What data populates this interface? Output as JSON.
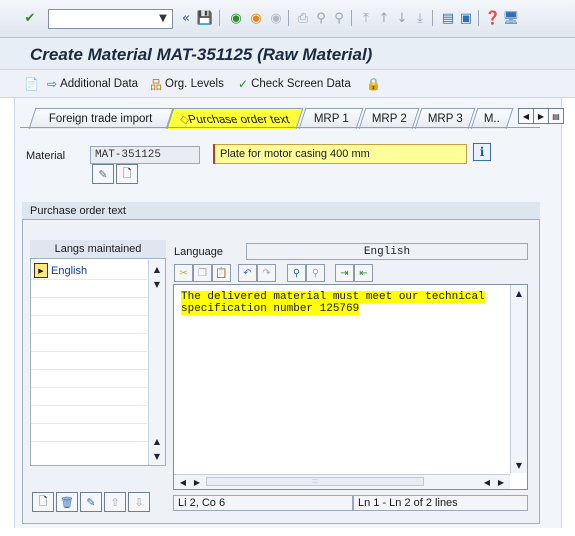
{
  "system_toolbar": {
    "command_field_value": "",
    "icons": [
      "enter-icon",
      "save-icon",
      "back-icon",
      "exit-icon",
      "cancel-icon",
      "print-icon",
      "find-icon",
      "find-next-icon",
      "first-page-icon",
      "prev-page-icon",
      "next-page-icon",
      "last-page-icon",
      "new-session-icon",
      "shortcut-icon",
      "help-icon",
      "customize-layout-icon"
    ]
  },
  "title": "Create Material MAT-351125 (Raw Material)",
  "app_toolbar": {
    "additional_data": "Additional Data",
    "org_levels": "Org. Levels",
    "check_screen_data": "Check Screen Data"
  },
  "tabs": [
    {
      "label": "Foreign trade import"
    },
    {
      "label": "Purchase order text",
      "active": true
    },
    {
      "label": "MRP 1"
    },
    {
      "label": "MRP 2"
    },
    {
      "label": "MRP 3"
    },
    {
      "label": "M.."
    }
  ],
  "material": {
    "label": "Material",
    "number": "MAT-351125",
    "description": "Plate for motor casing 400 mm"
  },
  "group": {
    "title": "Purchase order text",
    "langs_header": "Langs maintained",
    "langs": [
      "English"
    ],
    "language_label": "Language",
    "language_value": "English",
    "text_lines": [
      "The delivered material must meet our technical",
      "specification number 125769"
    ],
    "status_cursor": "Li 2, Co 6",
    "status_lines": "Ln 1 - Ln 2 of 2 lines"
  },
  "colors": {
    "active_tab": "#ffff3a",
    "highlight": "#ffff00",
    "title_text": "#1b2a3e"
  }
}
